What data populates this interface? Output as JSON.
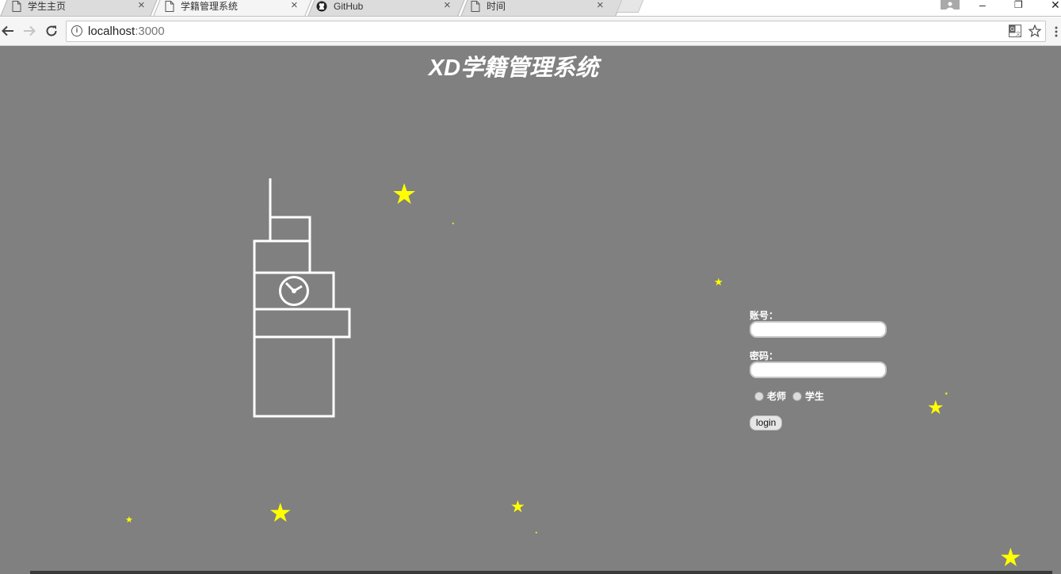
{
  "browser": {
    "tabs": [
      {
        "title": "学生主页",
        "icon": "page-icon",
        "active": false
      },
      {
        "title": "学籍管理系统",
        "icon": "page-icon",
        "active": true
      },
      {
        "title": "GitHub",
        "icon": "github-icon",
        "active": false
      },
      {
        "title": "时间",
        "icon": "page-icon",
        "active": false
      }
    ],
    "close_glyph": "×",
    "address": {
      "host": "localhost",
      "port": ":3000"
    },
    "window_controls": {
      "minimize": "–",
      "restore": "❐",
      "close": "✕"
    }
  },
  "page": {
    "title": "XD学籍管理系统",
    "form": {
      "account_label": "账号：",
      "password_label": "密码：",
      "account_value": "",
      "password_value": "",
      "roles": [
        {
          "label": "老师",
          "checked": false
        },
        {
          "label": "学生",
          "checked": false
        }
      ],
      "login_label": "login"
    },
    "colors": {
      "background": "#808080",
      "star": "#ffff00",
      "tower_stroke": "#ffffff"
    }
  }
}
